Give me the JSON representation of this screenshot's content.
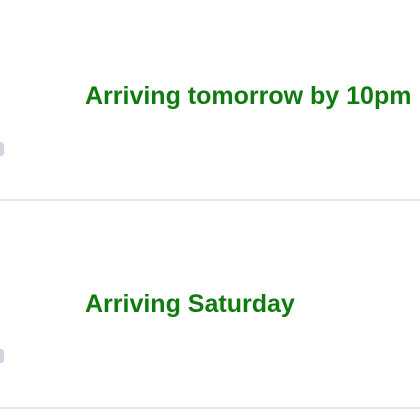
{
  "orders": [
    {
      "status": "Arriving tomorrow by 10pm",
      "status_color": "#0f7b0f"
    },
    {
      "status": "Arriving Saturday",
      "status_color": "#0f7b0f"
    }
  ]
}
